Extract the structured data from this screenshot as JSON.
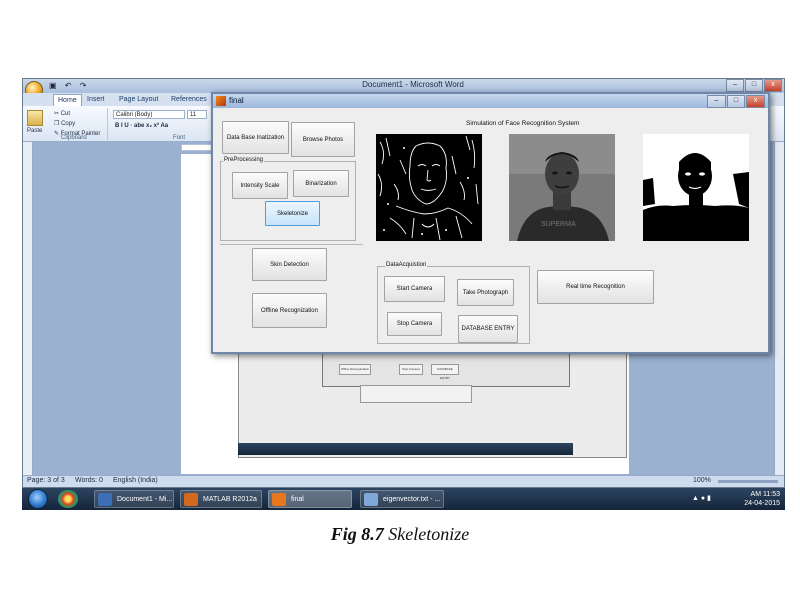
{
  "word": {
    "title": "Document1 - Microsoft Word",
    "quick_access": "▣ ↶ ↷",
    "window_buttons": [
      "–",
      "□",
      "x"
    ],
    "tabs": [
      "Home",
      "Insert",
      "Page Layout",
      "References"
    ],
    "clipboard": {
      "paste": "Paste",
      "cut": "Cut",
      "copy": "Copy",
      "format_painter": "Format Painter",
      "group": "Clipboard"
    },
    "font": {
      "name": "Calibri (Body)",
      "size": "11",
      "group": "Font",
      "format_buttons": "B  I  U  · abe  x₂  x²  Aa"
    },
    "status": {
      "page": "Page: 3 of 3",
      "words": "Words: 0",
      "language": "English (India)",
      "zoom": "100%"
    }
  },
  "taskbar": {
    "items": [
      {
        "label": "Document1 - Mi...",
        "icon_color": "#3d6fb6"
      },
      {
        "label": "MATLAB R2012a",
        "icon_color": "#d2691e"
      },
      {
        "label": "final",
        "icon_color": "#e8761c"
      },
      {
        "label": "eigenvector.txt - ...",
        "icon_color": "#7fa7d8"
      }
    ],
    "time": "AM 11:53",
    "date": "24-04-2015"
  },
  "figure": {
    "window_title": "final",
    "window_buttons": [
      "–",
      "□",
      "x"
    ],
    "buttons": {
      "database_init": "Data Base Inatization",
      "browse_photos": "Browse Photos",
      "intensity_scale": "Intensity Scale",
      "binarization": "Binarization",
      "skeletonize": "Skeletonize",
      "skin_detection": "Skin Detection",
      "offline_recognization": "Offline Recognization",
      "start_camera": "Start Camera",
      "take_photograph": "Take Photograph",
      "stop_camera": "Stop Camera",
      "database_entry": "DATABASE ENTRY",
      "realtime_recognition": "Real time Recognition"
    },
    "panels": {
      "preprocessing": "PreProcessing",
      "data_acquisition": "DataAcquistion"
    },
    "simulation_title": "Simulation of Face Recognition System"
  },
  "nested": {
    "offline": "Offline Recognization",
    "stop": "Stop Camera",
    "entry": "DATABASE ENTRY"
  },
  "caption": {
    "label": "Fig 8.7",
    "text": "Skeletonize"
  }
}
